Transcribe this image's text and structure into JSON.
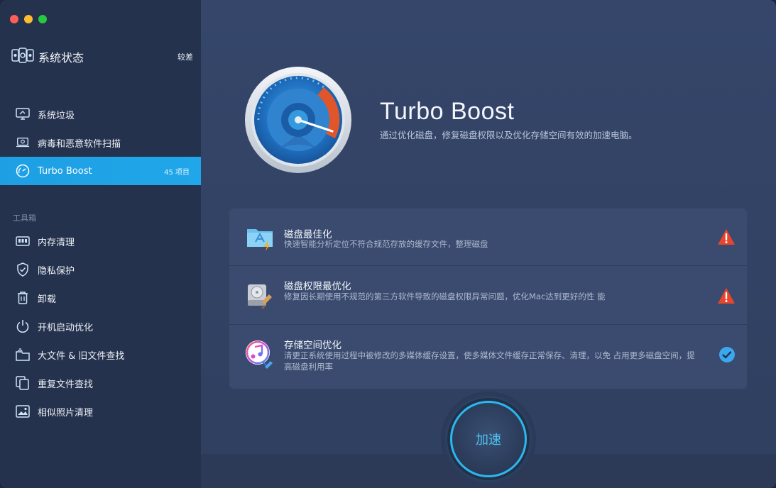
{
  "window": {
    "controls": [
      "close",
      "minimize",
      "zoom"
    ]
  },
  "sidebar": {
    "status": {
      "title": "系统状态",
      "badge": "较差",
      "icon": "monitor-status-icon"
    },
    "items": [
      {
        "label": "系统垃圾",
        "icon": "trash-monitor-icon"
      },
      {
        "label": "病毒和恶意软件扫描",
        "icon": "scan-laptop-icon"
      },
      {
        "label": "Turbo Boost",
        "icon": "speedometer-icon",
        "count": "45 项目",
        "active": true
      }
    ],
    "toolbox_label": "工具箱",
    "tools": [
      {
        "label": "内存清理",
        "icon": "memory-chip-icon"
      },
      {
        "label": "隐私保护",
        "icon": "shield-icon"
      },
      {
        "label": "卸载",
        "icon": "uninstall-bin-icon"
      },
      {
        "label": "开机启动优化",
        "icon": "power-icon"
      },
      {
        "label": "大文件 & 旧文件查找",
        "icon": "folder-stack-icon"
      },
      {
        "label": "重复文件查找",
        "icon": "duplicate-files-icon"
      },
      {
        "label": "相似照片清理",
        "icon": "photo-icon"
      }
    ]
  },
  "main": {
    "title": "Turbo Boost",
    "subtitle": "通过优化磁盘，修复磁盘权限以及优化存储空间有效的加速电脑。",
    "cards": [
      {
        "title": "磁盘最佳化",
        "desc": "快速智能分析定位不符合规范存放的缓存文件，整理磁盘",
        "icon": "app-folder-icon",
        "state": "warning"
      },
      {
        "title": "磁盘权限最优化",
        "desc": "修复因长期使用不规范的第三方软件导致的磁盘权限异常问题，优化Mac达到更好的性 能",
        "icon": "disk-repair-icon",
        "state": "warning"
      },
      {
        "title": "存储空间优化",
        "desc": "清更正系统使用过程中被修改的多媒体缓存设置，使多媒体文件缓存正常保存、清理，以免 占用更多磁盘空间，提高磁盘利用率",
        "icon": "music-app-icon",
        "state": "ok"
      }
    ],
    "action_label": "加速"
  },
  "colors": {
    "accent": "#20a7e9",
    "warning": "#e8452c",
    "ok": "#3aa8ec"
  }
}
